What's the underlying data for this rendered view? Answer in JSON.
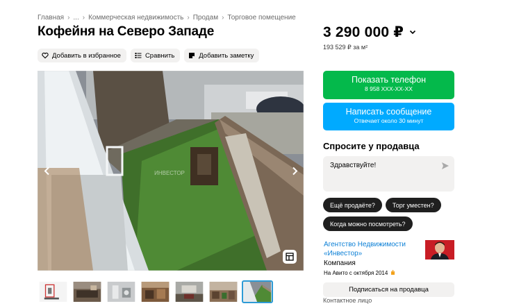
{
  "breadcrumb": [
    "Главная",
    "...",
    "Коммерческая недвижимость",
    "Продам",
    "Торговое помещение"
  ],
  "breadcrumb_sep": "›",
  "title": "Кофейня на Северо Западе",
  "actions": {
    "favorite": "Добавить в избранное",
    "compare": "Сравнить",
    "note": "Добавить заметку"
  },
  "gallery": {
    "watermark": "ИНВЕСТОР",
    "thumbnail_count": 7,
    "active_thumbnail": 7
  },
  "price": {
    "value": "3 290 000 ₽",
    "per_m2": "193 529 ₽ за м²"
  },
  "phone_button": {
    "label": "Показать телефон",
    "number": "8 958 XXX-XX-XX"
  },
  "message_button": {
    "label": "Написать сообщение",
    "sub": "Отвечает около 30 минут"
  },
  "ask": {
    "title": "Спросите у продавца",
    "input_value": "Здравствуйте!",
    "chips": [
      "Ещё продаёте?",
      "Торг уместен?",
      "Когда можно посмотреть?"
    ]
  },
  "seller": {
    "name": "Агентство Недвижимости «Инвестор»",
    "type": "Компания",
    "since": "На Авито с октября 2014"
  },
  "subscribe_label": "Подписаться на продавца",
  "contact_label": "Контактное лицо",
  "colors": {
    "green": "#04b94b",
    "blue": "#00aaff",
    "link": "#0a7fd6",
    "chip": "#1f1f1f",
    "thumb_active": "#2d9bd6"
  }
}
